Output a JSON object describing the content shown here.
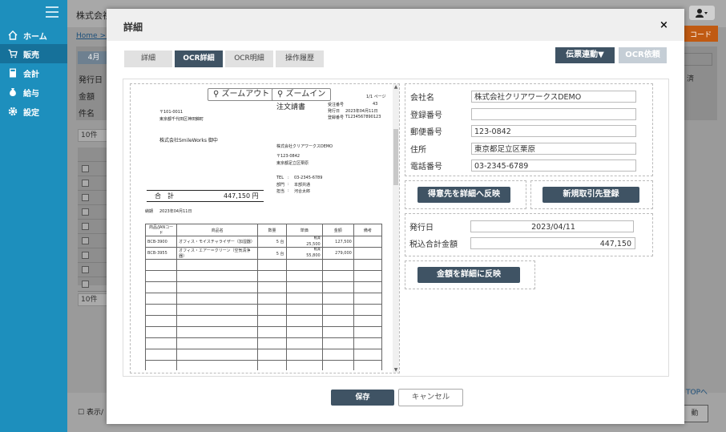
{
  "app": {
    "title": "株式会社",
    "breadcrumb": "Home > 販"
  },
  "sidebar": {
    "items": [
      {
        "label": "ホーム",
        "icon": "home-icon"
      },
      {
        "label": "販売",
        "icon": "cart-icon"
      },
      {
        "label": "会計",
        "icon": "calculator-icon"
      },
      {
        "label": "給与",
        "icon": "money-bag-icon"
      },
      {
        "label": "設定",
        "icon": "gear-icon"
      }
    ]
  },
  "background": {
    "orange_button": "コード",
    "tab_label": "4月",
    "labels": [
      "発行日",
      "金額",
      "件名"
    ],
    "right_label": "済",
    "page_size_top": "10件",
    "page_size_bottom": "10件",
    "show_checkbox_label": "表示/",
    "top_link": "TOPへ",
    "bottom_btn": "動"
  },
  "modal": {
    "title": "詳細",
    "close": "×",
    "tabs": [
      "詳細",
      "OCR詳細",
      "OCR明細",
      "操作履歴"
    ],
    "active_tab": 1,
    "slip_link_button": "伝票連動▼",
    "ocr_request_button": "OCR依頼",
    "save_button": "保存",
    "cancel_button": "キャンセル"
  },
  "viewer": {
    "zoom_out": "ズームアウト",
    "zoom_in": "ズームイン",
    "doc": {
      "page": "1/1 ページ",
      "title": "注文請書",
      "order_no_label": "受注番号",
      "order_no": "43",
      "issue_label": "発行日",
      "issue_date": "2023年04月11日",
      "reg_label": "登録番号",
      "reg_no": "T1234567890123",
      "to_postal": "〒101-0011",
      "to_address": "東京都千代田区神田錦町",
      "to_name": "株式会社SmileWorks 御中",
      "from_company": "株式会社クリアワークスDEMO",
      "from_postal": "〒123-0842",
      "from_address": "東京都足立区栗原",
      "tel_label": "TEL",
      "tel": "03-2345-6789",
      "dept_label": "部門",
      "dept": "本部共通",
      "person_label": "担当",
      "person": "河合太郎",
      "total_label": "合　計",
      "total": "447,150 円",
      "due_label": "納期",
      "due": "2023年04月11日",
      "headers": [
        "商品/JANコード",
        "商品名",
        "数量",
        "単価",
        "金額",
        "備考"
      ],
      "rows": [
        {
          "code": "BCB-3900",
          "name": "オフィス・モイスチャライザー（加湿器）",
          "qty": "5 台",
          "tax": "軽減",
          "price": "25,500",
          "amount": "127,500"
        },
        {
          "code": "BCB-3955",
          "name": "オフィス・エアー＝クリーン（空気清浄器）",
          "qty": "5 台",
          "tax": "軽減",
          "price": "55,800",
          "amount": "279,000"
        }
      ]
    }
  },
  "form": {
    "fields": [
      {
        "label": "会社名",
        "value": "株式会社クリアワークスDEMO"
      },
      {
        "label": "登録番号",
        "value": ""
      },
      {
        "label": "郵便番号",
        "value": "123-0842"
      },
      {
        "label": "住所",
        "value": "東京都足立区栗原"
      },
      {
        "label": "電話番号",
        "value": "03-2345-6789"
      }
    ],
    "reflect_customer_button": "得意先を詳細へ反映",
    "new_partner_button": "新規取引先登録",
    "issue_date_label": "発行日",
    "issue_date": "2023/04/11",
    "total_label": "税込合計金額",
    "total": "447,150",
    "reflect_amount_button": "金額を詳細に反映"
  }
}
